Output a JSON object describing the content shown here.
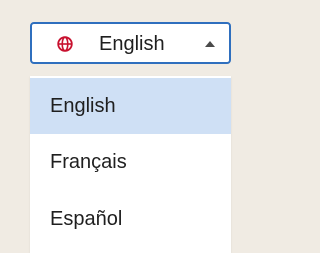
{
  "language_selector": {
    "selected_label": "English",
    "globe_icon": "globe-icon",
    "caret_icon": "caret-up-icon",
    "accent_color": "#2f6fbe",
    "globe_color": "#c8102e"
  },
  "menu": {
    "items": [
      {
        "label": "English",
        "selected": true
      },
      {
        "label": "Français",
        "selected": false
      },
      {
        "label": "Español",
        "selected": false
      }
    ],
    "selected_background": "#cfe0f5"
  }
}
